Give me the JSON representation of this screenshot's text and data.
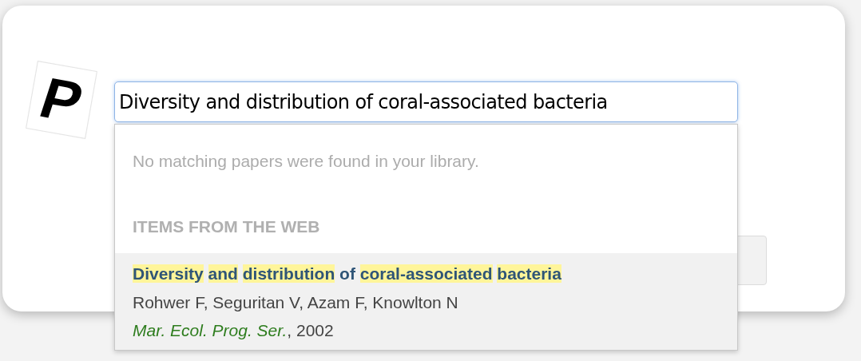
{
  "logo": {
    "letter": "P"
  },
  "search": {
    "value": "Diversity and distribution of coral-associated bacteria",
    "focused": true
  },
  "dropdown": {
    "library_message": "No matching papers were found in your library.",
    "section_heading": "ITEMS FROM THE WEB",
    "results": [
      {
        "title_words": [
          {
            "text": "Diversity",
            "highlighted": true
          },
          {
            "text": "and",
            "highlighted": true
          },
          {
            "text": "distribution",
            "highlighted": true
          },
          {
            "text": "of",
            "highlighted": false
          },
          {
            "text": "coral-associated",
            "highlighted": true
          },
          {
            "text": "bacteria",
            "highlighted": true
          }
        ],
        "authors": "Rohwer F, Seguritan V, Azam F, Knowlton N",
        "source": "*Mar. Ecol. Prog. Ser.*, 2002",
        "selected": true
      }
    ]
  }
}
